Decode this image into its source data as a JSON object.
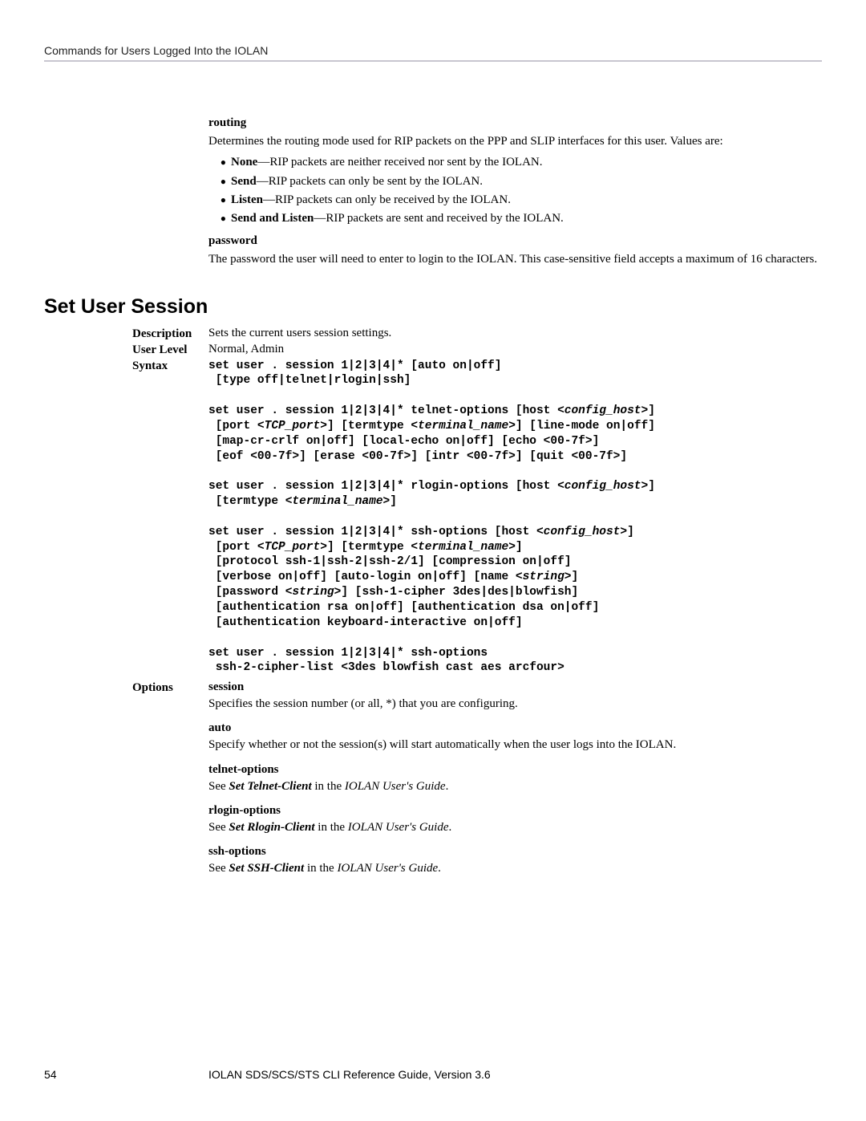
{
  "header": {
    "running": "Commands for Users Logged Into the IOLAN"
  },
  "routing": {
    "heading": "routing",
    "intro": "Determines the routing mode used for RIP packets on the PPP and SLIP interfaces for this user. Values are:",
    "items": [
      {
        "term": "None",
        "desc": "—RIP packets are neither received nor sent by the IOLAN."
      },
      {
        "term": "Send",
        "desc": "—RIP packets can only be sent by the IOLAN."
      },
      {
        "term": "Listen",
        "desc": "—RIP packets can only be received by the IOLAN."
      },
      {
        "term": "Send and Listen",
        "desc": "—RIP packets are sent and received by the IOLAN."
      }
    ]
  },
  "password": {
    "heading": "password",
    "body": "The password the user will need to enter to login to the IOLAN. This case-sensitive field accepts a maximum of 16 characters."
  },
  "section": {
    "title": "Set User Session",
    "description_label": "Description",
    "description": "Sets the current users session settings.",
    "userlevel_label": "User Level",
    "userlevel": "Normal, Admin",
    "syntax_label": "Syntax",
    "options_label": "Options"
  },
  "syntax": {
    "b1_l1a": "set user . session 1|2|3|4|* [auto on|off]",
    "b1_l2a": " [type off|telnet|rlogin|ssh]",
    "b2_l1a": "set user . session 1|2|3|4|* telnet-options [host <",
    "b2_l1i": "config_host",
    "b2_l1b": ">]",
    "b2_l2a": " [port <",
    "b2_l2i": "TCP_port",
    "b2_l2b": ">] [termtype <",
    "b2_l2j": "terminal_name",
    "b2_l2c": ">] [line-mode on|off]",
    "b2_l3a": " [map-cr-crlf on|off] [local-echo on|off] [echo <00-7f>]",
    "b2_l4a": " [eof <00-7f>] [erase <00-7f>] [intr <00-7f>] [quit <00-7f>]",
    "b3_l1a": "set user . session 1|2|3|4|* rlogin-options [host <",
    "b3_l1i": "config_host",
    "b3_l1b": ">]",
    "b3_l2a": " [termtype <",
    "b3_l2i": "terminal_name",
    "b3_l2b": ">]",
    "b4_l1a": "set user . session 1|2|3|4|* ssh-options [host <",
    "b4_l1i": "config_host",
    "b4_l1b": ">]",
    "b4_l2a": " [port <",
    "b4_l2i": "TCP_port",
    "b4_l2b": ">] [termtype <",
    "b4_l2j": "terminal_name",
    "b4_l2c": ">]",
    "b4_l3a": " [protocol ssh-1|ssh-2|ssh-2/1] [compression on|off]",
    "b4_l4a": " [verbose on|off] [auto-login on|off] [name <",
    "b4_l4i": "string",
    "b4_l4b": ">]",
    "b4_l5a": " [password <",
    "b4_l5i": "string",
    "b4_l5b": ">] [ssh-1-cipher 3des|des|blowfish]",
    "b4_l6a": " [authentication rsa on|off] [authentication dsa on|off]",
    "b4_l7a": " [authentication keyboard-interactive on|off]",
    "b5_l1a": "set user . session 1|2|3|4|* ssh-options",
    "b5_l2a": " ssh-2-cipher-list <3des blowfish cast aes arcfour>"
  },
  "options": {
    "session": {
      "name": "session",
      "desc": "Specifies the session number (or all, *) that you are configuring."
    },
    "auto": {
      "name": "auto",
      "desc": "Specify whether or not the session(s) will start automatically when the user logs into the IOLAN."
    },
    "telnet": {
      "name": "telnet-options",
      "pre": "See ",
      "ref": "Set Telnet-Client",
      "mid": " in the ",
      "guide": "IOLAN User's Guide",
      "post": "."
    },
    "rlogin": {
      "name": "rlogin-options",
      "pre": "See ",
      "ref": "Set Rlogin-Client",
      "mid": " in the ",
      "guide": "IOLAN User's Guide",
      "post": "."
    },
    "ssh": {
      "name": "ssh-options",
      "pre": "See ",
      "ref": "Set SSH-Client",
      "mid": " in the ",
      "guide": "IOLAN User's Guide",
      "post": "."
    }
  },
  "footer": {
    "page": "54",
    "text": "IOLAN SDS/SCS/STS CLI Reference Guide, Version 3.6"
  }
}
